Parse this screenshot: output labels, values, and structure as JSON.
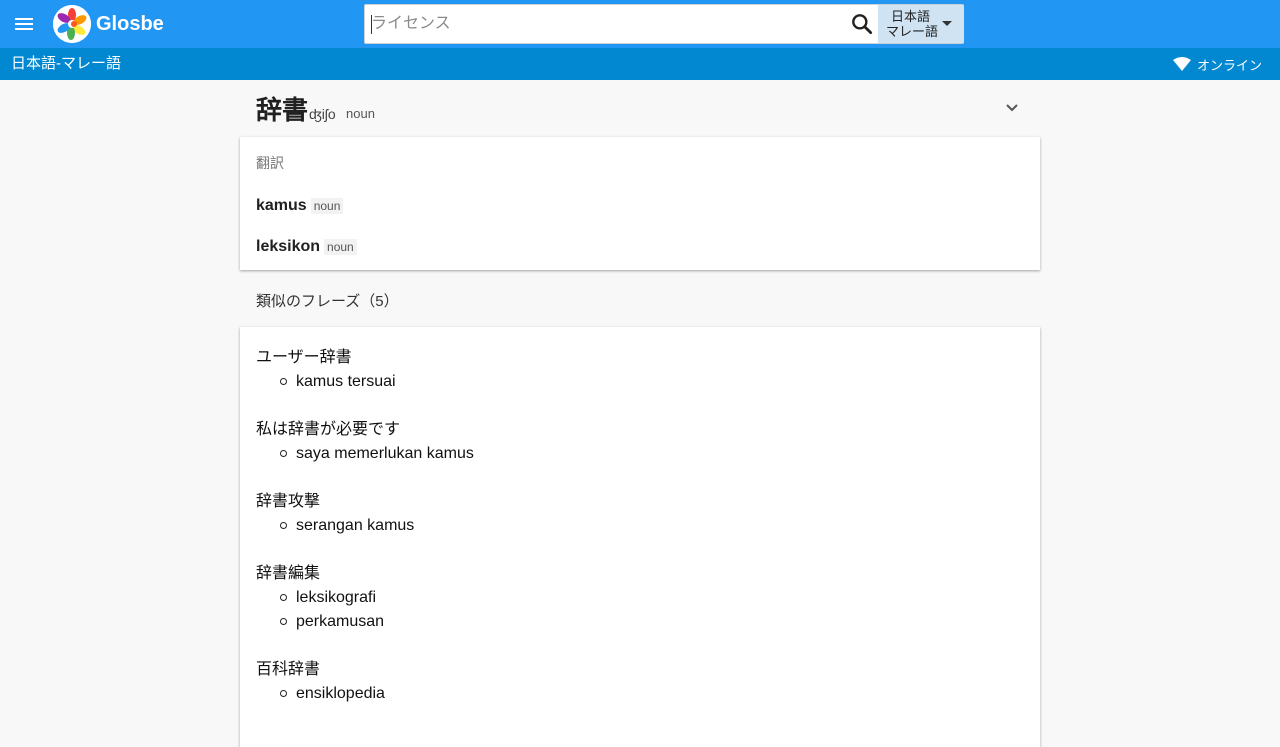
{
  "header": {
    "brand": "Glosbe",
    "search": {
      "placeholder": "ライセンス",
      "value": ""
    },
    "language_select": {
      "line1": "日本語",
      "line2": "マレー語"
    },
    "icons": {
      "menu": "menu-icon",
      "search": "search-icon",
      "dropdown": "dropdown-arrow-icon"
    }
  },
  "subheader": {
    "language_pair": "日本語-マレー語",
    "status": "オンライン",
    "status_icon": "wifi-icon"
  },
  "entry": {
    "headword": "辞書",
    "pronunciation": "ʤiʃo",
    "part_of_speech": "noun"
  },
  "translations": {
    "label": "翻訳",
    "items": [
      {
        "word": "kamus",
        "pos": "noun"
      },
      {
        "word": "leksikon",
        "pos": "noun"
      }
    ]
  },
  "similar_phrases": {
    "heading": "類似のフレーズ（5）",
    "groups": [
      {
        "source": "ユーザー辞書",
        "targets": [
          "kamus tersuai"
        ]
      },
      {
        "source": "私は辞書が必要です",
        "targets": [
          "saya memerlukan kamus"
        ]
      },
      {
        "source": "辞書攻撃",
        "targets": [
          "serangan kamus"
        ]
      },
      {
        "source": "辞書編集",
        "targets": [
          "leksikografi",
          "perkamusan"
        ]
      },
      {
        "source": "百科辞書",
        "targets": [
          "ensiklopedia"
        ]
      }
    ]
  },
  "colors": {
    "topbar": "#2196f3",
    "subbar": "#0288d1",
    "language_select_bg": "#cfe3f3"
  }
}
